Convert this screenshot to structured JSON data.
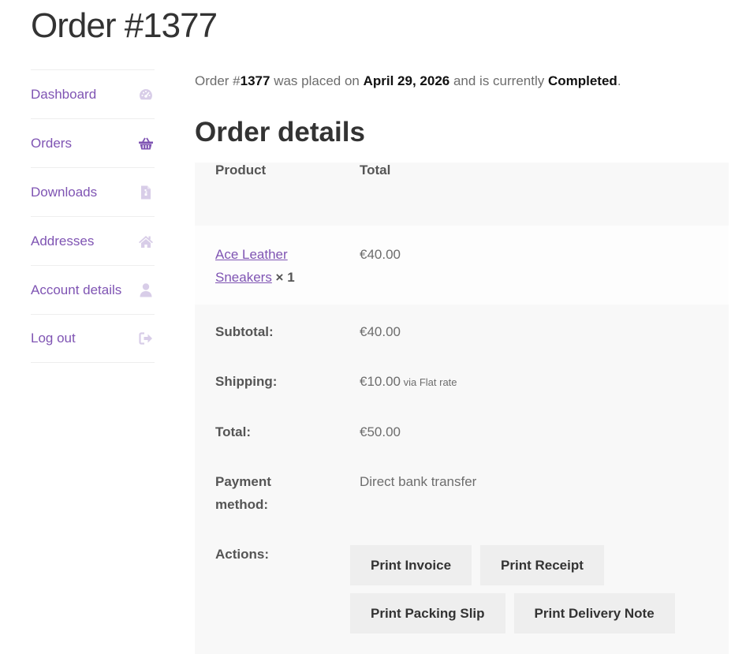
{
  "page": {
    "title": "Order #1377"
  },
  "sidebar": {
    "items": [
      {
        "label": "Dashboard",
        "icon": "dashboard-gauge-icon",
        "active": false
      },
      {
        "label": "Orders",
        "icon": "basket-icon",
        "active": true
      },
      {
        "label": "Downloads",
        "icon": "file-download-icon",
        "active": false
      },
      {
        "label": "Addresses",
        "icon": "home-icon",
        "active": false
      },
      {
        "label": "Account details",
        "icon": "user-icon",
        "active": false
      },
      {
        "label": "Log out",
        "icon": "logout-icon",
        "active": false
      }
    ]
  },
  "summary": {
    "prefix": "Order #",
    "order_number": "1377",
    "placed_text": " was placed on ",
    "date": "April 29, 2026",
    "status_text": " and is currently ",
    "status": "Completed",
    "end": "."
  },
  "details": {
    "title": "Order details",
    "header": {
      "product": "Product",
      "total": "Total"
    },
    "item": {
      "name_line1": "Ace Leather",
      "name_line2": "Sneakers",
      "qty": " × 1",
      "total": "€40.00"
    },
    "subtotal": {
      "label": "Subtotal:",
      "value": "€40.00"
    },
    "shipping": {
      "label": "Shipping:",
      "value": "€10.00",
      "method": " via Flat rate"
    },
    "total": {
      "label": "Total:",
      "value": "€50.00"
    },
    "payment": {
      "label_line1": "Payment",
      "label_line2": "method:",
      "value": "Direct bank transfer"
    },
    "actions": {
      "label": "Actions:",
      "buttons": [
        "Print Invoice",
        "Print Receipt",
        "Print Packing Slip",
        "Print Delivery Note"
      ]
    }
  },
  "colors": {
    "accent": "#7f54b3",
    "icon_muted": "#d8cde8",
    "table_bg": "#f8f8f8",
    "button_bg": "#eeeeee"
  }
}
